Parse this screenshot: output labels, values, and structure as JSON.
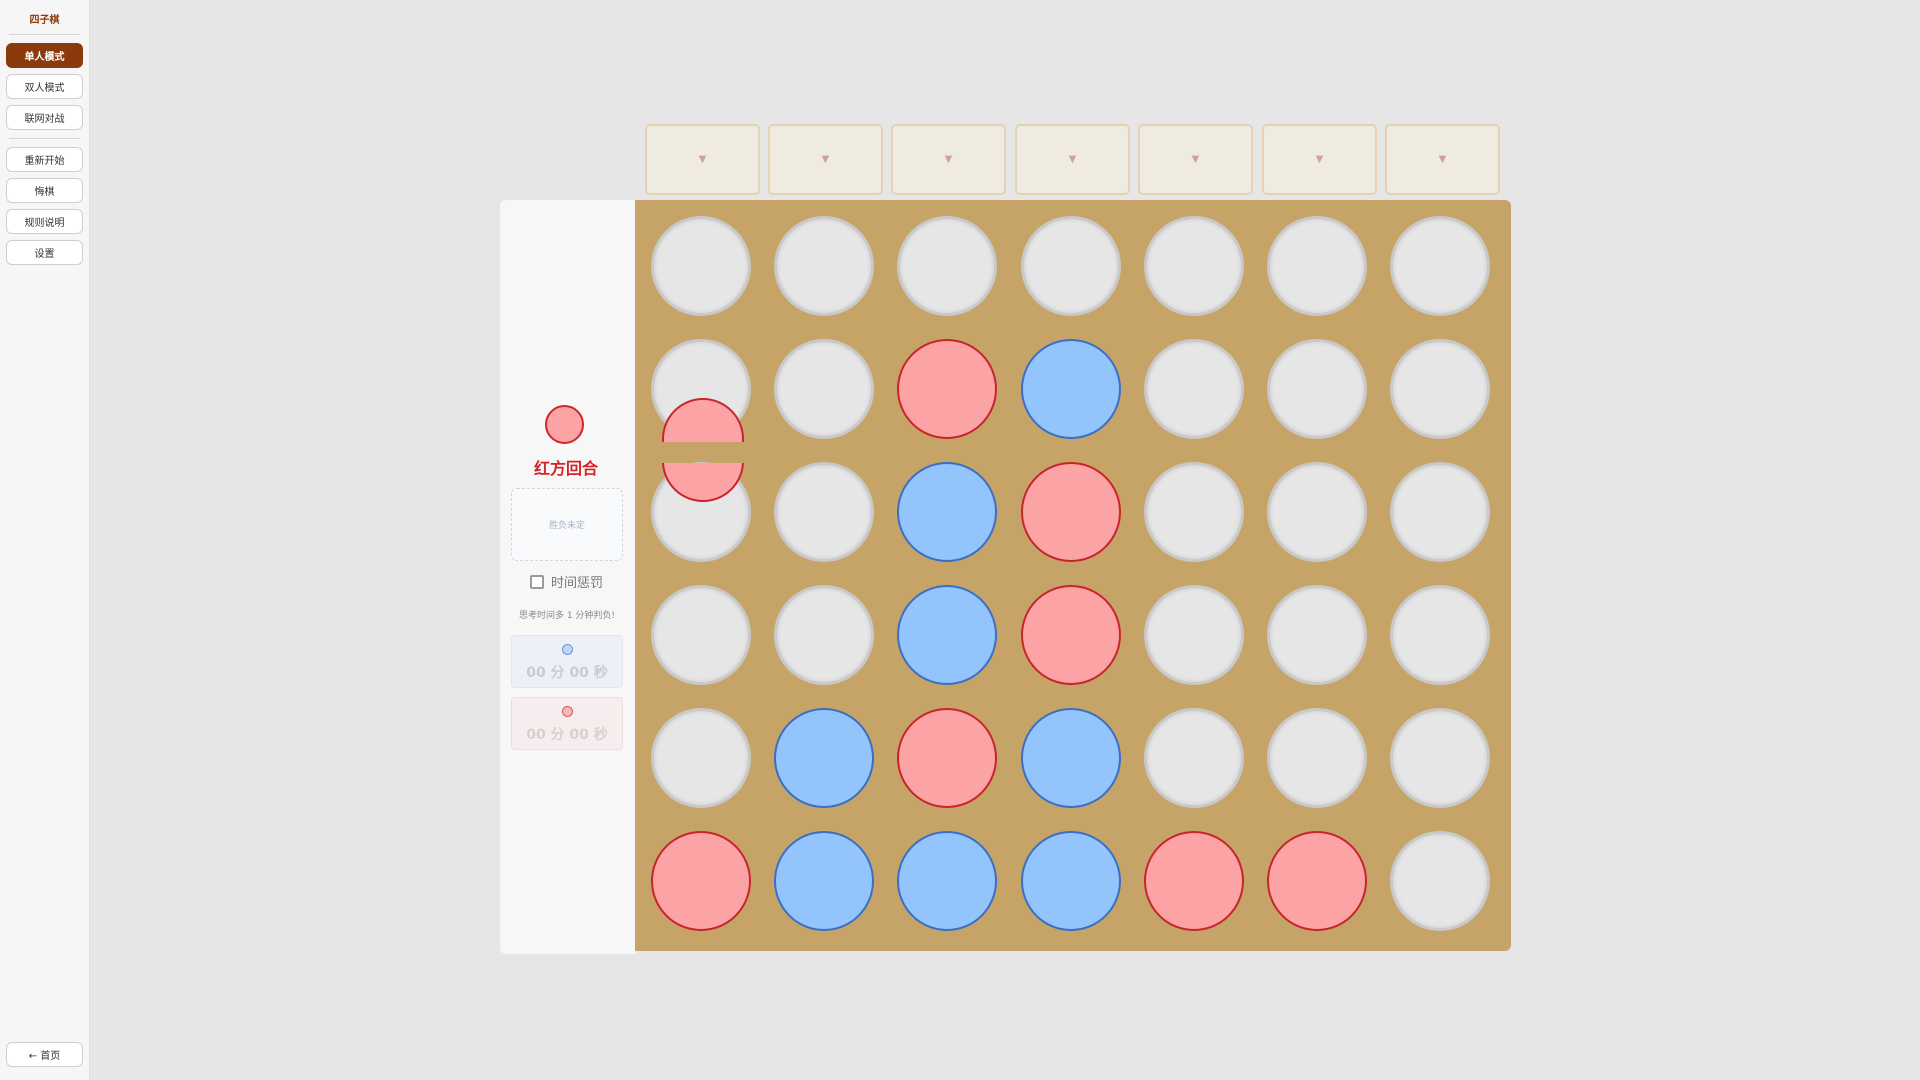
{
  "sidebar": {
    "title": "四子棋",
    "modes": [
      {
        "label": "单人模式",
        "active": true
      },
      {
        "label": "双人模式",
        "active": false
      },
      {
        "label": "联网对战",
        "active": false
      }
    ],
    "actions": [
      "重新开始",
      "悔棋",
      "规则说明",
      "设置"
    ],
    "home_label": "← 首页"
  },
  "drop_arrow": "▼",
  "status": {
    "turn_label": "红方回合",
    "result_text": "胜负未定",
    "timer_toggle_label": "时间惩罚",
    "timer_toggle_checked": false,
    "timer_note": "思考时间多 1 分钟判负!"
  },
  "clocks": {
    "blue": "00 分 00 秒",
    "red": "00 分 00 秒"
  },
  "board": {
    "columns": 7,
    "rows": 6,
    "falling_disc": {
      "color": "red",
      "column": 0
    },
    "cells": [
      [
        "empty",
        "empty",
        "empty",
        "empty",
        "empty",
        "empty",
        "empty"
      ],
      [
        "empty",
        "empty",
        "red",
        "blue",
        "empty",
        "empty",
        "empty"
      ],
      [
        "empty",
        "empty",
        "blue",
        "red",
        "empty",
        "empty",
        "empty"
      ],
      [
        "empty",
        "empty",
        "blue",
        "red",
        "empty",
        "empty",
        "empty"
      ],
      [
        "empty",
        "blue",
        "red",
        "blue",
        "empty",
        "empty",
        "empty"
      ],
      [
        "red",
        "blue",
        "blue",
        "blue",
        "red",
        "red",
        "empty"
      ]
    ]
  },
  "colors": {
    "brand": "#8b3a0e",
    "board": "#c6a467",
    "red_disc": "#fca3a5",
    "blue_disc": "#94c4fc",
    "empty_cell": "#e6e6e6"
  }
}
